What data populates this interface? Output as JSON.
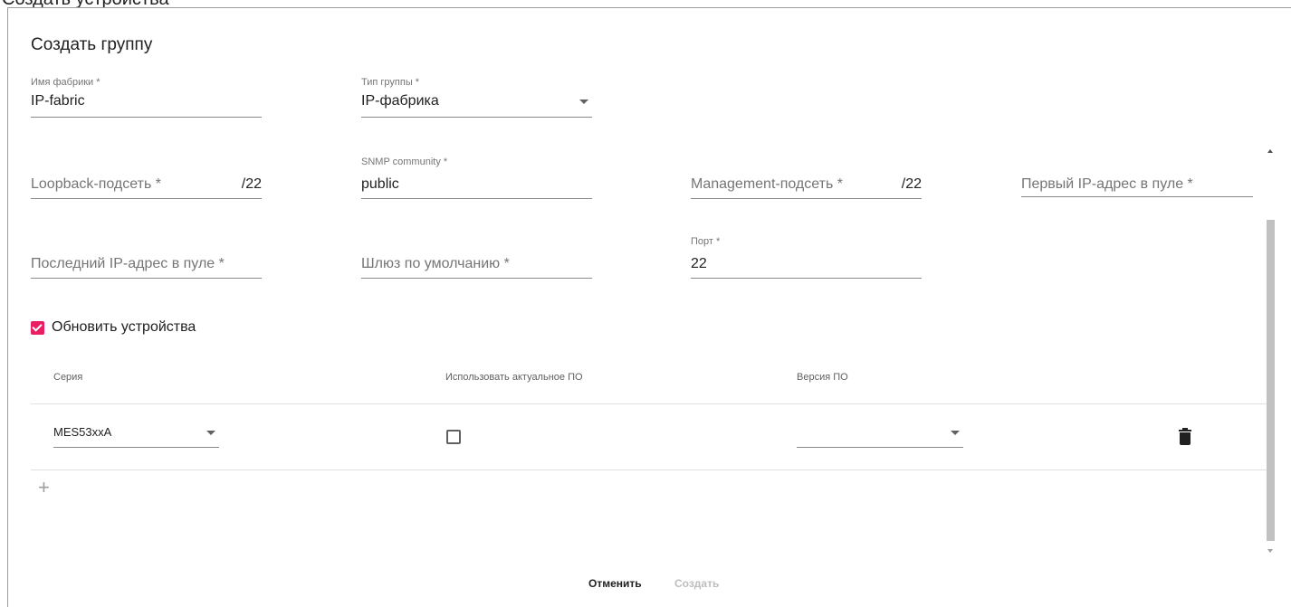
{
  "page_title_cut": "Создать устройства",
  "dialog": {
    "title": "Создать группу",
    "fabric_name": {
      "label": "Имя фабрики *",
      "value": "IP-fabric"
    },
    "group_type": {
      "label": "Тип группы *",
      "value": "IP-фабрика"
    },
    "loopback_subnet": {
      "placeholder": "Loopback-подсеть *",
      "suffix": "/22"
    },
    "snmp_community": {
      "label": "SNMP community *",
      "value": "public"
    },
    "management_subnet": {
      "placeholder": "Management-подсеть *",
      "suffix": "/22"
    },
    "first_ip": {
      "placeholder": "Первый IP-адрес в пуле *"
    },
    "last_ip": {
      "placeholder": "Последний IP-адрес в пуле *"
    },
    "default_gateway": {
      "placeholder": "Шлюз по умолчанию *"
    },
    "port": {
      "label": "Порт *",
      "value": "22"
    },
    "update_devices": {
      "label": "Обновить устройства",
      "checked": true
    },
    "table": {
      "headers": [
        "Серия",
        "Использовать актуальное ПО",
        "Версия ПО"
      ],
      "rows": [
        {
          "series": "MES53xxA",
          "use_latest": false,
          "version": ""
        }
      ]
    },
    "add_symbol": "+",
    "cancel_label": "Отменить",
    "create_label": "Создать"
  },
  "colors": {
    "accent": "#e91e63",
    "disabled": "#bdbdbd"
  },
  "icons": [
    "chevron-down-icon",
    "check-icon",
    "trash-icon",
    "plus-icon"
  ]
}
